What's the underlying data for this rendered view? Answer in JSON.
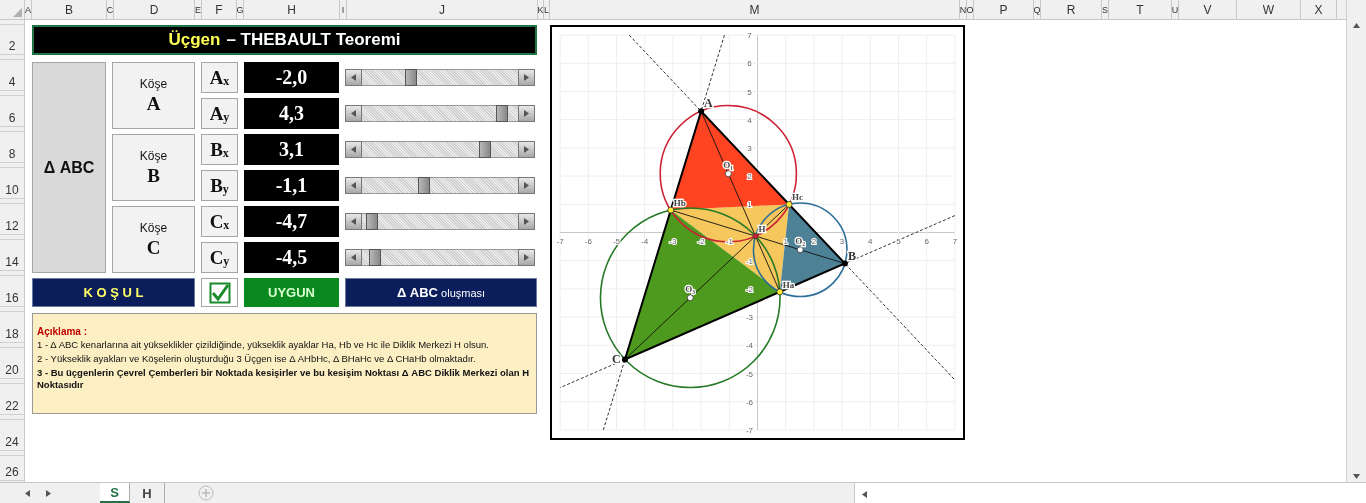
{
  "columns": [
    "A",
    "B",
    "C",
    "D",
    "E",
    "F",
    "G",
    "H",
    "I",
    "J",
    "K",
    "L",
    "M",
    "N",
    "O",
    "P",
    "Q",
    "R",
    "S",
    "T",
    "U",
    "V",
    "W",
    "X"
  ],
  "rows": [
    "2",
    "4",
    "6",
    "8",
    "10",
    "12",
    "14",
    "16",
    "18",
    "20",
    "22",
    "24",
    "26"
  ],
  "title": {
    "highlight": "Üçgen",
    "rest": "– THEBAULT Teoremi"
  },
  "triangle_label": "Δ ABC",
  "vertices": [
    {
      "caption": "Köşe",
      "name": "A",
      "coords": [
        {
          "letter": "A",
          "sub": "x",
          "value": "-2,0",
          "level": 0.3
        },
        {
          "letter": "A",
          "sub": "y",
          "value": "4,3",
          "level": 0.93
        }
      ]
    },
    {
      "caption": "Köşe",
      "name": "B",
      "coords": [
        {
          "letter": "B",
          "sub": "x",
          "value": "3,1",
          "level": 0.81
        },
        {
          "letter": "B",
          "sub": "y",
          "value": "-1,1",
          "level": 0.39
        }
      ]
    },
    {
      "caption": "Köşe",
      "name": "C",
      "coords": [
        {
          "letter": "C",
          "sub": "x",
          "value": "-4,7",
          "level": 0.03
        },
        {
          "letter": "C",
          "sub": "y",
          "value": "-4,5",
          "level": 0.05
        }
      ]
    }
  ],
  "condition": {
    "label": "K O Ş U L",
    "checked": true,
    "status": "UYGUN",
    "description": "**Δ ABC** oluşması"
  },
  "note": {
    "heading": "Açıklama :",
    "lines": [
      {
        "text": "1 - Δ ABC kenarlarına ait yükseklikler çizildiğinde, yükseklik ayaklar Ha, Hb ve Hc ile Diklik Merkezi H olsun.",
        "bold": false
      },
      {
        "text": "2 - Yükseklik ayakları ve Köşelerin oluşturduğu 3 Üçgen ise Δ AHbHc, Δ BHaHc ve Δ CHaHb olmaktadır.",
        "bold": false
      },
      {
        "text": "3 - Bu üçgenlerin Çevrel Çemberleri bir Noktada kesişirler ve bu kesişim Noktası Δ ABC Diklik Merkezi olan H Noktasıdır",
        "bold": true
      }
    ]
  },
  "diagram": {
    "x_ticks": [
      "-7",
      "-6",
      "-5",
      "-4",
      "-3",
      "-2",
      "-1",
      "1",
      "2",
      "3",
      "4",
      "5",
      "6",
      "7"
    ],
    "y_ticks": [
      "7",
      "6",
      "5",
      "4",
      "3",
      "2",
      "1",
      "-1",
      "-2",
      "-3",
      "-4",
      "-5",
      "-6",
      "-7"
    ],
    "vertex_labels": [
      "A",
      "B",
      "C"
    ],
    "foot_labels": [
      "Ha",
      "Hb",
      "Hc"
    ],
    "orthocenter_label": "H",
    "center_labels": [
      "O₁",
      "O₂",
      "O₃"
    ],
    "corner_regions": [
      {
        "color": "#ff4422"
      },
      {
        "color": "#4c8196"
      },
      {
        "color": "#4e9a1e"
      }
    ],
    "inner_region": {
      "color": "#f6c75c"
    },
    "circles": [
      {
        "color": "#cc2233"
      },
      {
        "color": "#2b6e98"
      },
      {
        "color": "#267a26"
      }
    ]
  },
  "sheet_tabs": [
    {
      "label": "S",
      "selected": true
    },
    {
      "label": "H",
      "selected": false
    }
  ]
}
